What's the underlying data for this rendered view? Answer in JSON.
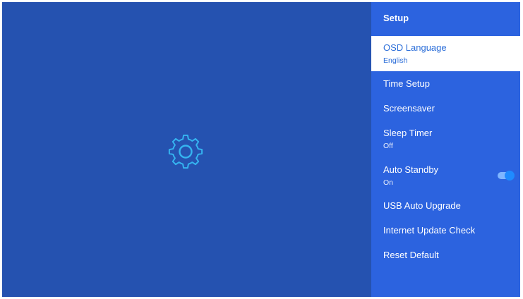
{
  "panel": {
    "title": "Setup",
    "items": [
      {
        "label": "OSD Language",
        "value": "English",
        "selected": true
      },
      {
        "label": "Time Setup"
      },
      {
        "label": "Screensaver"
      },
      {
        "label": "Sleep Timer",
        "value": "Off"
      },
      {
        "label": "Auto Standby",
        "value": "On",
        "toggle": true
      },
      {
        "label": "USB Auto Upgrade"
      },
      {
        "label": "Internet Update Check"
      },
      {
        "label": "Reset Default"
      }
    ]
  },
  "main": {
    "icon": "gear-icon"
  },
  "colors": {
    "background": "#2552b0",
    "panel": "#2c63df",
    "accent": "#2d6fd9",
    "gear": "#35b4f0",
    "toggle_on": "#1f8bff"
  }
}
